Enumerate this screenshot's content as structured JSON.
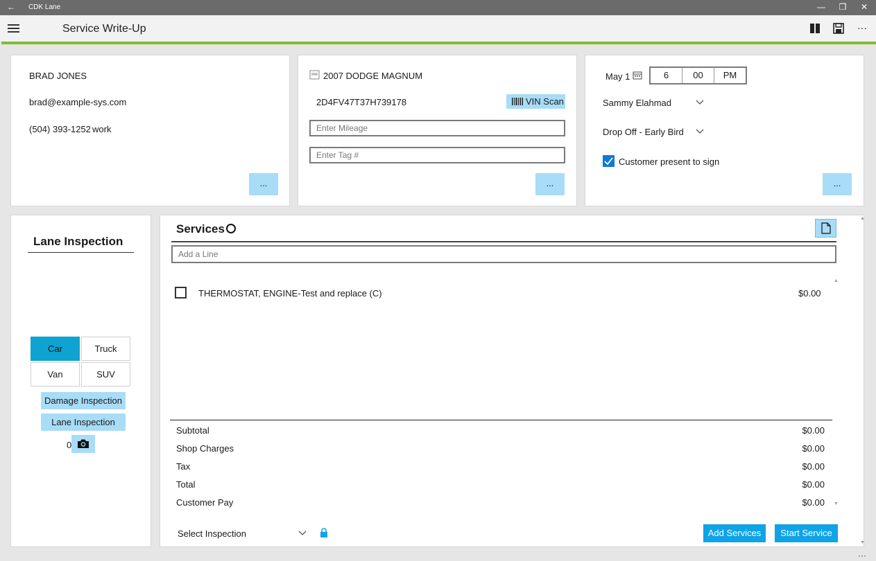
{
  "window": {
    "app_title": "CDK Lane",
    "back_glyph": "←",
    "minimize_glyph": "—",
    "restore_glyph": "❐",
    "close_glyph": "✕"
  },
  "appbar": {
    "page_title": "Service Write-Up",
    "more_glyph": "···"
  },
  "customer": {
    "name": "BRAD JONES",
    "email": "brad@example-sys.com",
    "phone": "(504) 393-1252",
    "phone_type": "work",
    "more_label": "..."
  },
  "vehicle": {
    "title": "2007 DODGE MAGNUM",
    "vin": "2D4FV47T37H739178",
    "vin_scan_label": "VIN Scan",
    "mileage_placeholder": "Enter Mileage",
    "tag_placeholder": "Enter Tag #",
    "more_label": "..."
  },
  "appointment": {
    "date": "May 1",
    "hour": "6",
    "minute": "00",
    "ampm": "PM",
    "advisor": "Sammy Elahmad",
    "drop_off": "Drop Off - Early Bird",
    "customer_present_label": "Customer present to sign",
    "customer_present_checked": true,
    "more_label": "..."
  },
  "lane_inspection": {
    "heading": "Lane Inspection",
    "vehicle_types": [
      "Car",
      "Truck",
      "Van",
      "SUV"
    ],
    "selected_type": "Car",
    "damage_btn": "Damage Inspection",
    "lane_btn": "Lane Inspection",
    "photo_count": "0"
  },
  "services": {
    "heading": "Services",
    "add_line_placeholder": "Add a Line",
    "lines": [
      {
        "description": "THERMOSTAT, ENGINE-Test and replace (C)",
        "amount": "$0.00",
        "checked": false
      }
    ],
    "summary": [
      {
        "label": "Subtotal",
        "value": "$0.00"
      },
      {
        "label": "Shop Charges",
        "value": "$0.00"
      },
      {
        "label": "Tax",
        "value": "$0.00"
      },
      {
        "label": "Total",
        "value": "$0.00"
      },
      {
        "label": "Customer Pay",
        "value": "$0.00"
      }
    ],
    "select_inspection": "Select Inspection",
    "add_services_btn": "Add Services",
    "start_service_btn": "Start Service"
  },
  "footer": {
    "more_glyph": "···"
  },
  "colors": {
    "accent_green": "#7ebd34",
    "button_light_blue": "#a8dcf7",
    "selected_blue": "#0fa3d1",
    "primary_blue": "#0fa3e8"
  }
}
